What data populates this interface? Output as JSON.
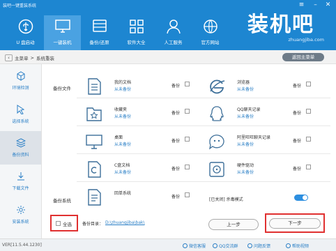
{
  "app_title": "装吧一键重装系统",
  "nav": [
    {
      "label": "U 盘启动",
      "icon": "usb-icon"
    },
    {
      "label": "一键装机",
      "icon": "monitor-icon"
    },
    {
      "label": "备份/还原",
      "icon": "backup-icon"
    },
    {
      "label": "软件大全",
      "icon": "apps-grid-icon"
    },
    {
      "label": "人工服务",
      "icon": "person-icon"
    },
    {
      "label": "官方网站",
      "icon": "globe-icon"
    }
  ],
  "brand": {
    "name": "装机吧",
    "site": "zhuangjiba.com"
  },
  "breadcrumb": {
    "home": "主菜单",
    "sep": ">",
    "current": "系统重装"
  },
  "return_button": "返回主菜单",
  "sidebar": [
    {
      "label": "环境检测",
      "icon": "cube-icon"
    },
    {
      "label": "选择系统",
      "icon": "cursor-icon"
    },
    {
      "label": "备份资料",
      "icon": "layers-icon"
    },
    {
      "label": "下载文件",
      "icon": "download-icon"
    },
    {
      "label": "安装系统",
      "icon": "gear-icon"
    }
  ],
  "sections": {
    "files": "备份文件",
    "system": "备份系统"
  },
  "backup_label": "备份",
  "items_left": [
    {
      "title": "我的文档",
      "status": "从未备份",
      "icon": "document-icon"
    },
    {
      "title": "收藏夹",
      "status": "从未备份",
      "icon": "favorites-folder-icon"
    },
    {
      "title": "桌面",
      "status": "从未备份",
      "icon": "desktop-icon"
    },
    {
      "title": "C盘文档",
      "status": "从未备份",
      "icon": "c-drive-doc-icon"
    },
    {
      "title": "回单系统",
      "status": "",
      "icon": "system-doc-icon"
    }
  ],
  "items_right": [
    {
      "title": "浏览器",
      "status": "从未备份",
      "icon": "browser-icon"
    },
    {
      "title": "QQ聊天记录",
      "status": "从未备份",
      "icon": "qq-icon"
    },
    {
      "title": "阿里旺旺聊天记录",
      "status": "从未备份",
      "icon": "wangwang-icon"
    },
    {
      "title": "硬件驱动",
      "status": "从未备份",
      "icon": "hardware-driver-icon"
    }
  ],
  "compress_mode": "[已关闭] 杀毒模式",
  "select_all": "全选",
  "backup_dir_label": "备份目录：",
  "backup_dir_path": "D:\\zhuangjiba\\bak\\",
  "prev_button": "上一步",
  "next_button": "下一步",
  "status": {
    "version": "VER[11.5.44.1230]",
    "links": [
      "微信客服",
      "QQ交流群",
      "问题反馈",
      "帮助视频"
    ]
  }
}
